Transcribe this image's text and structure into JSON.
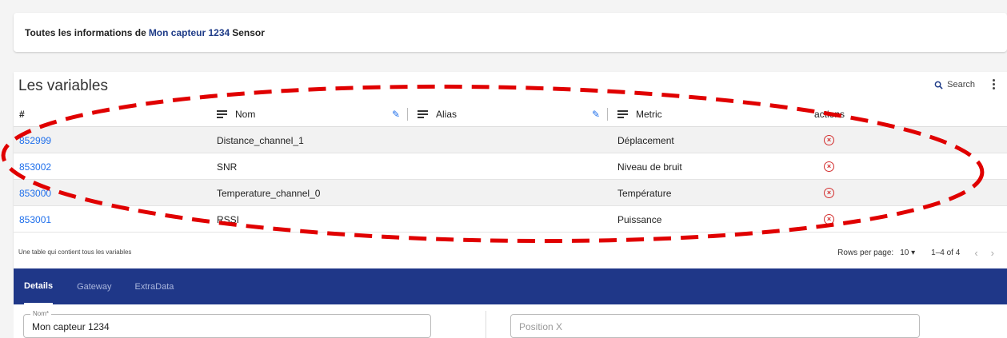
{
  "info": {
    "prefix": "Toutes les informations de",
    "sensor_name": "Mon capteur 1234",
    "suffix": "Sensor"
  },
  "variables": {
    "title": "Les variables",
    "search_label": "Search",
    "columns": [
      "#",
      "Nom",
      "Alias",
      "Metric",
      "actions"
    ],
    "rows": [
      {
        "id": "852999",
        "nom": "Distance_channel_1",
        "alias": "",
        "metric": "Déplacement"
      },
      {
        "id": "853002",
        "nom": "SNR",
        "alias": "",
        "metric": "Niveau de bruit"
      },
      {
        "id": "853000",
        "nom": "Temperature_channel_0",
        "alias": "",
        "metric": "Température"
      },
      {
        "id": "853001",
        "nom": "RSSI",
        "alias": "",
        "metric": "Puissance"
      }
    ],
    "footer": "Une table qui contient tous les variables",
    "rows_per_page_label": "Rows per page:",
    "rows_per_page": "10",
    "range": "1–4 of 4"
  },
  "tabs": [
    "Details",
    "Gateway",
    "ExtraData"
  ],
  "form": {
    "nom_label": "Nom*",
    "nom_value": "Mon capteur 1234",
    "position_x_placeholder": "Position X"
  },
  "colors": {
    "primary": "#1f3788",
    "link": "#1f6feb",
    "delete": "#d32f2f",
    "annotation": "#e00000"
  }
}
